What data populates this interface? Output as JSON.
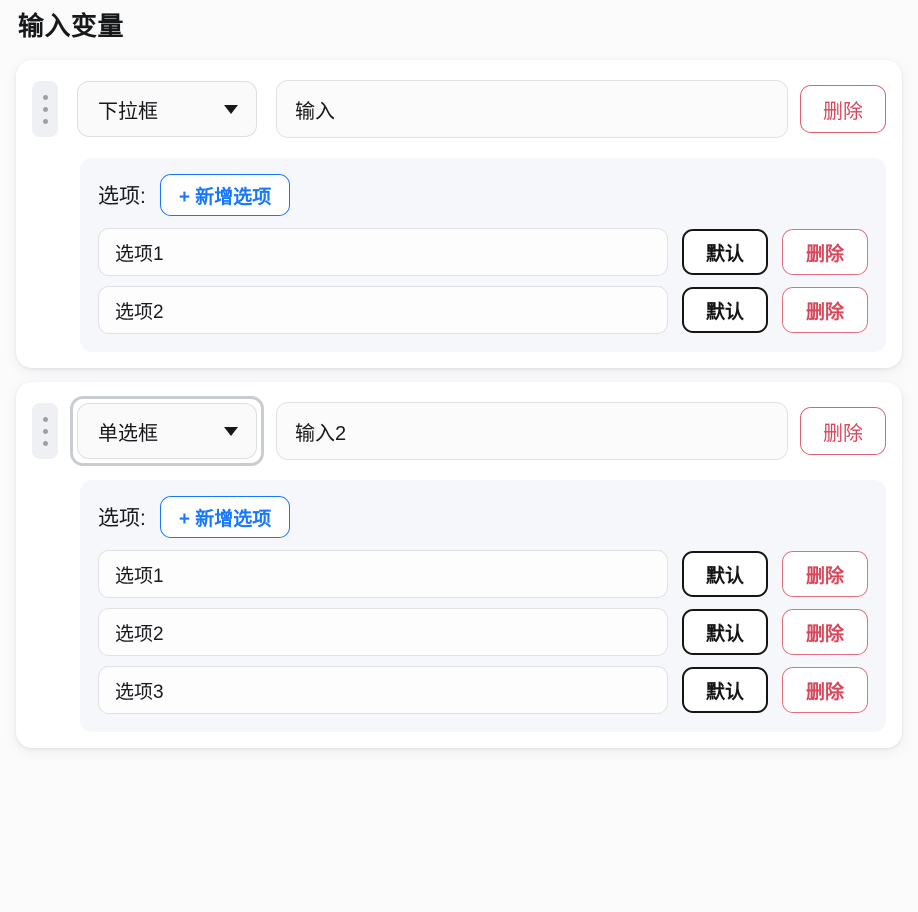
{
  "page": {
    "title": "输入变量"
  },
  "labels": {
    "options_label": "选项:",
    "add_option": "+ 新增选项",
    "delete_variable": "删除",
    "default": "默认",
    "delete_option": "删除"
  },
  "colors": {
    "page_background": "#fbfbfc",
    "card_background": "#ffffff",
    "options_panel_background": "#f5f7fa",
    "accent_blue": "#1677ff",
    "danger_red": "#d8485c",
    "default_black": "#141414",
    "focus_ring": "#c9ccd1",
    "handle_background": "#eef0f3",
    "handle_dot": "#9aa0a8"
  },
  "variables": [
    {
      "type": "下拉框",
      "type_focused": false,
      "name_value": "输入",
      "name_placeholder": "输入",
      "options": [
        {
          "value": "选项1",
          "placeholder": "选项1"
        },
        {
          "value": "选项2",
          "placeholder": "选项2"
        }
      ]
    },
    {
      "type": "单选框",
      "type_focused": true,
      "name_value": "输入2",
      "name_placeholder": "输入2",
      "options": [
        {
          "value": "选项1",
          "placeholder": "选项1"
        },
        {
          "value": "选项2",
          "placeholder": "选项2"
        },
        {
          "value": "选项3",
          "placeholder": "选项3"
        }
      ]
    }
  ]
}
